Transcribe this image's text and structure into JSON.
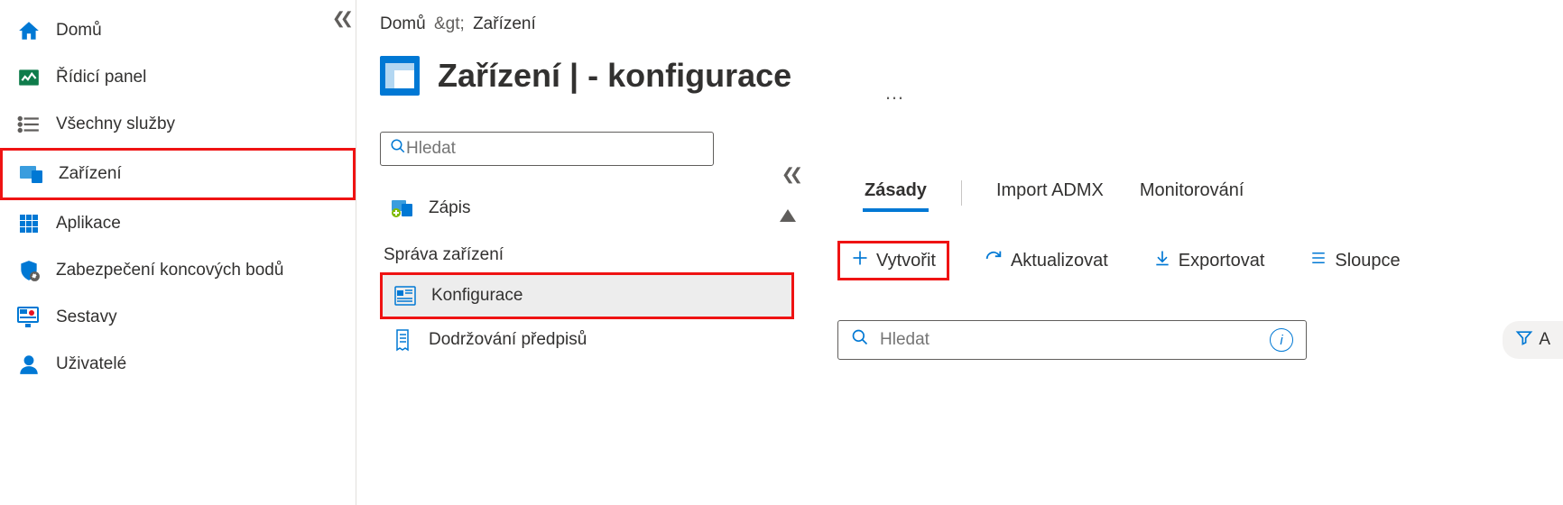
{
  "sidebar": {
    "items": [
      {
        "label": "Domů"
      },
      {
        "label": "Řídicí panel"
      },
      {
        "label": "Všechny služby"
      },
      {
        "label": "Zařízení"
      },
      {
        "label": "Aplikace"
      },
      {
        "label": "Zabezpečení koncových bodů"
      },
      {
        "label": "Sestavy"
      },
      {
        "label": "Uživatelé"
      }
    ]
  },
  "breadcrumb": {
    "home": "Domů",
    "sep": ">",
    "current": "Zařízení"
  },
  "page": {
    "title": "Zařízení | - konfigurace"
  },
  "midsearch": {
    "placeholder": "Hledat"
  },
  "subnav": {
    "items": [
      {
        "label": "Zápis"
      }
    ],
    "group_header": "Správa zařízení",
    "group_items": [
      {
        "label": "Konfigurace"
      },
      {
        "label": "Dodržování předpisů"
      }
    ]
  },
  "tabs": {
    "policies": "Zásady",
    "import_admx": "Import ADMX",
    "monitoring": "Monitorování"
  },
  "toolbar": {
    "create": "Vytvořit",
    "refresh": "Aktualizovat",
    "export": "Exportovat",
    "columns": "Sloupce"
  },
  "content_search": {
    "placeholder": "Hledat"
  },
  "filter": {
    "label": "A"
  }
}
